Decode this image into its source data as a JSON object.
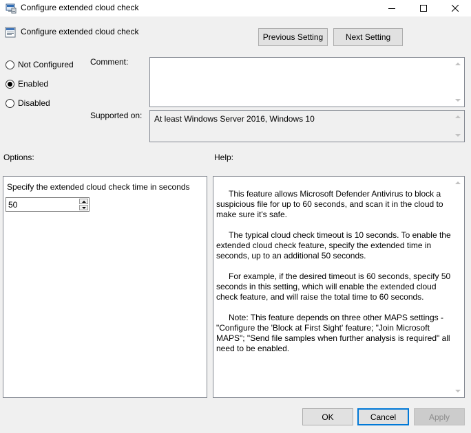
{
  "window": {
    "title": "Configure extended cloud check",
    "icons": {
      "app": "policy-editor-icon",
      "minimize": "minimize-icon",
      "maximize": "maximize-icon",
      "close": "close-icon"
    }
  },
  "header": {
    "policy_title": "Configure extended cloud check",
    "prev_label": "Previous Setting",
    "next_label": "Next Setting"
  },
  "state": {
    "options": [
      {
        "label": "Not Configured",
        "checked": false
      },
      {
        "label": "Enabled",
        "checked": true
      },
      {
        "label": "Disabled",
        "checked": false
      }
    ]
  },
  "comment": {
    "label": "Comment:",
    "value": ""
  },
  "supported": {
    "label": "Supported on:",
    "value": "At least Windows Server 2016, Windows 10"
  },
  "options_section": {
    "label": "Options:",
    "field_label": "Specify the extended cloud check time in seconds",
    "field_value": "50"
  },
  "help_section": {
    "label": "Help:",
    "paragraphs": [
      "This feature allows Microsoft Defender Antivirus to block a suspicious file for up to 60 seconds, and scan it in the cloud to make sure it's safe.",
      "The typical cloud check timeout is 10 seconds. To enable the extended cloud check feature, specify the extended time in seconds, up to an additional 50 seconds.",
      "For example, if the desired timeout is 60 seconds, specify 50 seconds in this setting, which will enable the extended cloud check feature, and will raise the total time to 60 seconds.",
      "Note: This feature depends on three other MAPS settings - \"Configure the 'Block at First Sight' feature; \"Join Microsoft MAPS\"; \"Send file samples when further analysis is required\" all need to be enabled."
    ]
  },
  "footer": {
    "ok_label": "OK",
    "cancel_label": "Cancel",
    "apply_label": "Apply"
  },
  "colors": {
    "accent": "#0078d7",
    "background": "#f0f0f0",
    "disabled_text": "#8d8d8d"
  }
}
